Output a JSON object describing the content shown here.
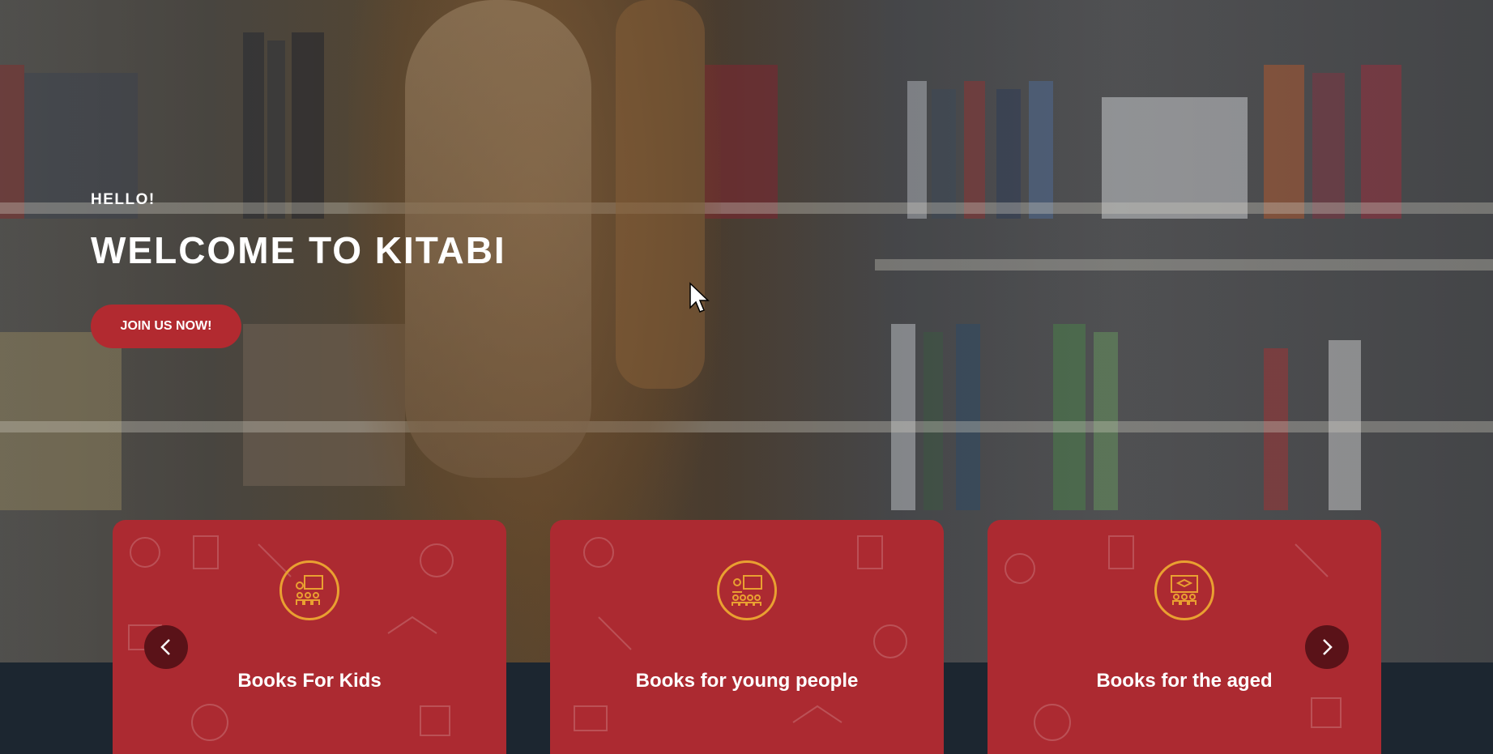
{
  "hero": {
    "eyebrow": "HELLO!",
    "title": "WELCOME TO KITABI",
    "cta_label": "JOIN US NOW!"
  },
  "cards": [
    {
      "title": "Books For Kids",
      "icon": "kids-classroom-icon"
    },
    {
      "title": "Books for young people",
      "icon": "presentation-audience-icon"
    },
    {
      "title": "Books for the aged",
      "icon": "graduation-board-icon"
    }
  ],
  "carousel": {
    "prev_icon": "chevron-left-icon",
    "next_icon": "chevron-right-icon"
  },
  "colors": {
    "accent": "#b22a30",
    "card": "#ac2a31",
    "icon_ring": "#e9a031",
    "arrow_bg": "#5a1218",
    "band": "#1c2630"
  }
}
